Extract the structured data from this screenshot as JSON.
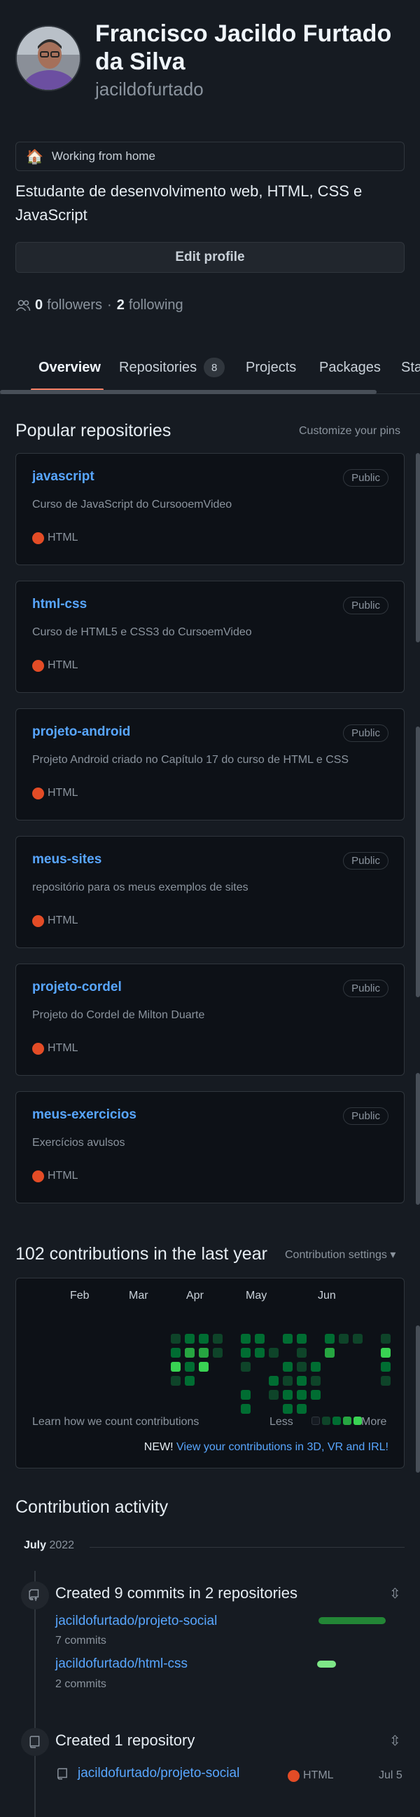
{
  "profile": {
    "name": "Francisco Jacildo Furtado da Silva",
    "login": "jacildofurtado",
    "status_emoji": "🏠",
    "status_text": "Working from home",
    "bio": "Estudante de desenvolvimento web, HTML, CSS e JavaScript",
    "edit_button": "Edit profile",
    "followers_count": "0",
    "followers_label": "followers",
    "separator": "·",
    "following_count": "2",
    "following_label": "following"
  },
  "tabs": [
    {
      "label": "Overview",
      "active": true
    },
    {
      "label": "Repositories",
      "counter": "8"
    },
    {
      "label": "Projects"
    },
    {
      "label": "Packages"
    },
    {
      "label": "Sta"
    }
  ],
  "pinned": {
    "title": "Popular repositories",
    "customize": "Customize your pins",
    "repos": [
      {
        "name": "javascript",
        "visibility": "Public",
        "description": "Curso de JavaScript do CursooemVideo",
        "language": "HTML"
      },
      {
        "name": "html-css",
        "visibility": "Public",
        "description": "Curso de HTML5 e CSS3 do CursoemVideo",
        "language": "HTML"
      },
      {
        "name": "projeto-android",
        "visibility": "Public",
        "description": "Projeto Android criado no Capítulo 17 do curso de HTML e CSS",
        "language": "HTML"
      },
      {
        "name": "meus-sites",
        "visibility": "Public",
        "description": "repositório para os meus exemplos de sites",
        "language": "HTML"
      },
      {
        "name": "projeto-cordel",
        "visibility": "Public",
        "description": "Projeto do Cordel de Milton Duarte",
        "language": "HTML"
      },
      {
        "name": "meus-exercicios",
        "visibility": "Public",
        "description": "Exercícios avulsos",
        "language": "HTML"
      }
    ],
    "language_color": "#e34c26"
  },
  "contributions": {
    "title": "102 contributions in the last year",
    "settings": "Contribution settings",
    "months": [
      "Feb",
      "Mar",
      "Apr",
      "May",
      "Jun"
    ],
    "learn": "Learn how we count contributions",
    "less": "Less",
    "more": "More",
    "new_prefix": "NEW!",
    "new_link": "View your contributions in 3D, VR and IRL!"
  },
  "activity": {
    "title": "Contribution activity",
    "month": "July",
    "year": "2022",
    "commits_title": "Created 9 commits in 2 repositories",
    "commit_repos": [
      {
        "name": "jacildofurtado/projeto-social",
        "commits": "7 commits",
        "share": 0.78
      },
      {
        "name": "jacildofurtado/html-css",
        "commits": "2 commits",
        "share": 0.22
      }
    ],
    "created_title": "Created 1 repository",
    "created_repo": "jacildofurtado/projeto-social",
    "created_lang": "HTML",
    "created_date": "Jul 5"
  }
}
